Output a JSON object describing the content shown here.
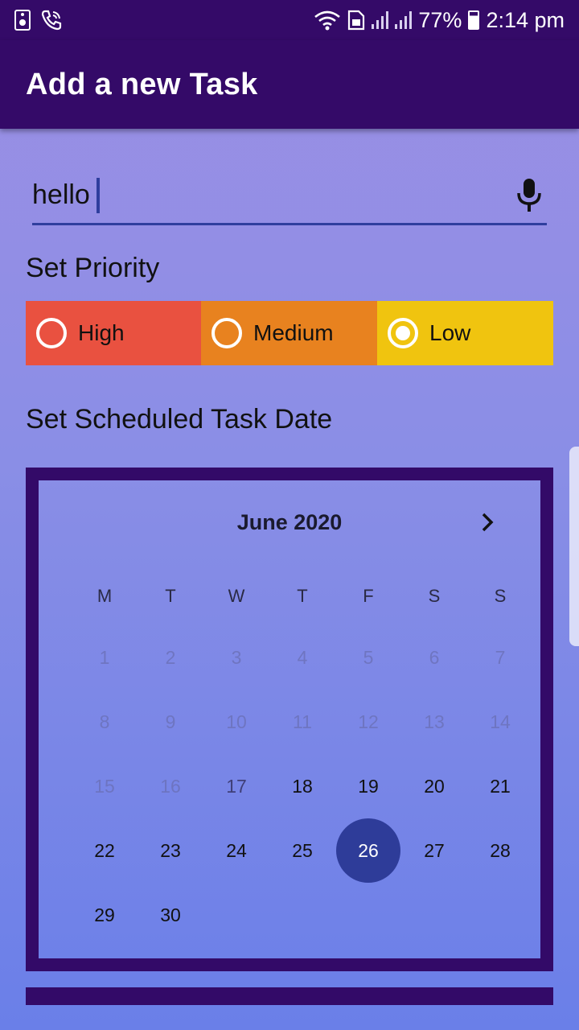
{
  "status_bar": {
    "battery": "77%",
    "time": "2:14 pm"
  },
  "app_bar": {
    "title": "Add a new Task"
  },
  "task_input": {
    "value": "hello"
  },
  "priority": {
    "label": "Set Priority",
    "options": [
      {
        "label": "High",
        "color": "#e95140",
        "selected": false
      },
      {
        "label": "Medium",
        "color": "#e8821f",
        "selected": false
      },
      {
        "label": "Low",
        "color": "#f0c40f",
        "selected": true
      }
    ]
  },
  "schedule": {
    "label": "Set Scheduled Task Date"
  },
  "calendar": {
    "month_title": "June 2020",
    "weekdays": [
      "M",
      "T",
      "W",
      "T",
      "F",
      "S",
      "S"
    ],
    "days": [
      "1",
      "2",
      "3",
      "4",
      "5",
      "6",
      "7",
      "8",
      "9",
      "10",
      "11",
      "12",
      "13",
      "14",
      "15",
      "16",
      "17",
      "18",
      "19",
      "20",
      "21",
      "22",
      "23",
      "24",
      "25",
      "26",
      "27",
      "28",
      "29",
      "30"
    ],
    "first_selectable_day": 17,
    "selected_day": 26
  },
  "colors": {
    "primary_dark": "#340a68",
    "accent": "#2e3c99"
  }
}
